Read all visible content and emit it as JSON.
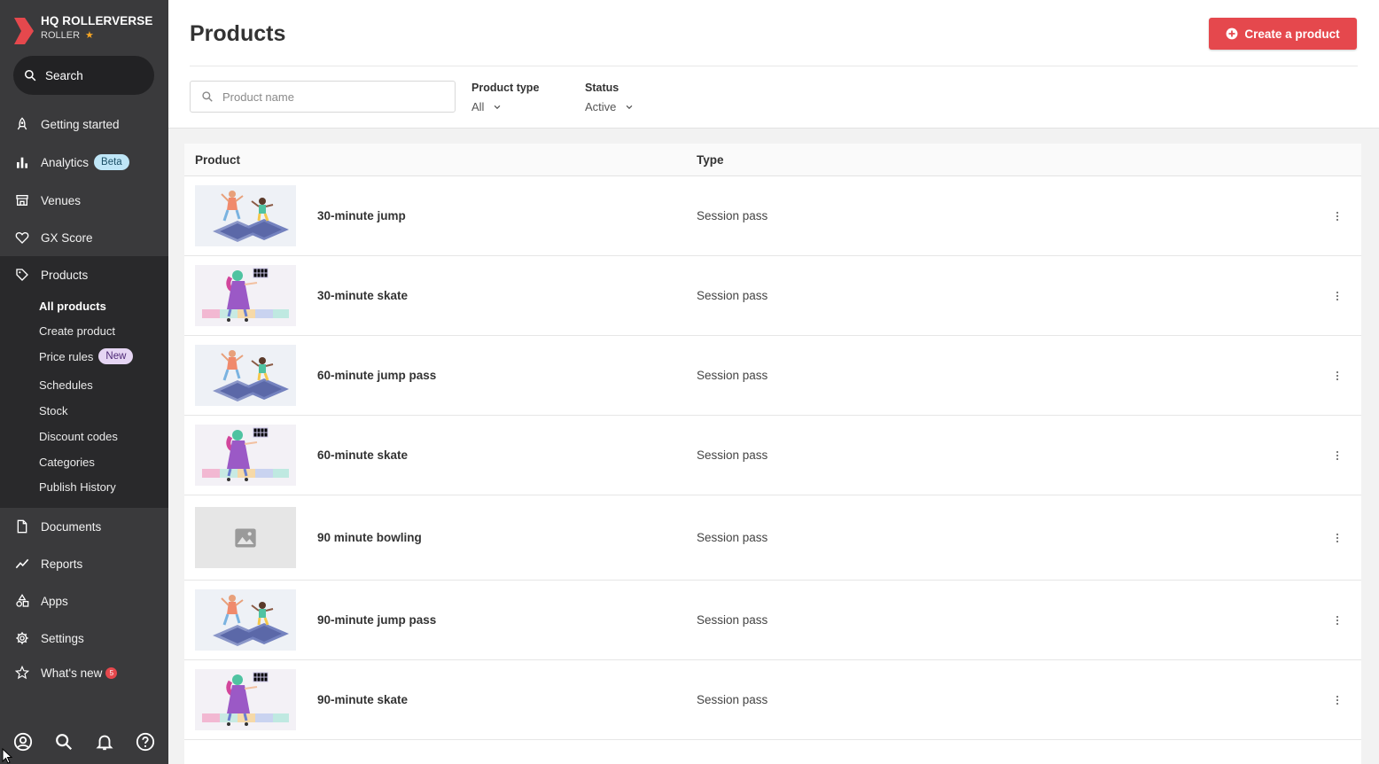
{
  "brand": {
    "name": "HQ ROLLERVERSE",
    "sub": "ROLLER",
    "star": "★"
  },
  "sidebar": {
    "search_label": "Search",
    "items": [
      {
        "label": "Getting started",
        "icon": "rocket-icon"
      },
      {
        "label": "Analytics",
        "icon": "bar-chart-icon",
        "badge": "Beta"
      },
      {
        "label": "Venues",
        "icon": "store-icon"
      },
      {
        "label": "GX Score",
        "icon": "heart-icon"
      },
      {
        "label": "Products",
        "icon": "tag-icon"
      },
      {
        "label": "Documents",
        "icon": "document-icon"
      },
      {
        "label": "Reports",
        "icon": "trend-line-icon"
      },
      {
        "label": "Apps",
        "icon": "apps-shapes-icon"
      },
      {
        "label": "Settings",
        "icon": "gear-icon"
      },
      {
        "label": "What's new",
        "icon": "star-icon",
        "count": "5"
      }
    ],
    "product_sub_items": [
      {
        "label": "All products",
        "active": true
      },
      {
        "label": "Create product"
      },
      {
        "label": "Price rules",
        "badge": "New"
      },
      {
        "label": "Schedules"
      },
      {
        "label": "Stock"
      },
      {
        "label": "Discount codes"
      },
      {
        "label": "Categories"
      },
      {
        "label": "Publish History"
      }
    ],
    "bottom_icons": [
      "account-icon",
      "search-icon",
      "bell-icon",
      "help-icon"
    ]
  },
  "header": {
    "title": "Products",
    "create_button": "Create a product"
  },
  "filters": {
    "search_placeholder": "Product name",
    "product_type": {
      "label": "Product type",
      "value": "All"
    },
    "status": {
      "label": "Status",
      "value": "Active"
    }
  },
  "table": {
    "columns": [
      "Product",
      "Type"
    ],
    "rows": [
      {
        "name": "30-minute jump",
        "type": "Session pass",
        "image": "jump-illustration"
      },
      {
        "name": "30-minute skate",
        "type": "Session pass",
        "image": "skate-illustration"
      },
      {
        "name": "60-minute jump pass",
        "type": "Session pass",
        "image": "jump-illustration"
      },
      {
        "name": "60-minute skate",
        "type": "Session pass",
        "image": "skate-illustration"
      },
      {
        "name": "90 minute bowling",
        "type": "Session pass",
        "image": "image-placeholder"
      },
      {
        "name": "90-minute jump pass",
        "type": "Session pass",
        "image": "jump-illustration"
      },
      {
        "name": "90-minute skate",
        "type": "Session pass",
        "image": "skate-illustration"
      }
    ]
  },
  "colors": {
    "accent": "#e5484d",
    "sidebar_bg": "#3a3a3c",
    "sidebar_group_bg": "#29292b"
  }
}
